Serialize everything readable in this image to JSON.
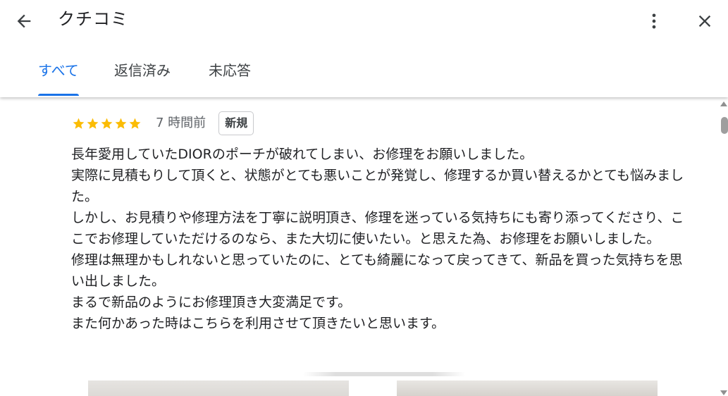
{
  "header": {
    "title": "クチコミ",
    "back_icon": "arrow-left-icon",
    "more_icon": "more-vert-icon",
    "close_icon": "close-icon"
  },
  "tabs": [
    {
      "label": "すべて",
      "active": true
    },
    {
      "label": "返信済み",
      "active": false
    },
    {
      "label": "未応答",
      "active": false
    }
  ],
  "review": {
    "rating": 5,
    "rating_max": 5,
    "star_color": "#fbbc04",
    "time_ago": "7 時間前",
    "badge": "新規",
    "paragraphs": [
      "長年愛用していたDIORのポーチが破れてしまい、お修理をお願いしました。",
      "実際に見積もりして頂くと、状態がとても悪いことが発覚し、修理するか買い替えるかとても悩みました。",
      "しかし、お見積りや修理方法を丁寧に説明頂き、修理を迷っている気持ちにも寄り添ってくださり、ここでお修理していただけるのなら、また大切に使いたい。と思えた為、お修理をお願いしました。",
      "修理は無理かもしれないと思っていたのに、とても綺麗になって戻ってきて、新品を買った気持ちを思い出しました。",
      "まるで新品のようにお修理頂き大変満足です。",
      "また何かあった時はこちらを利用させて頂きたいと思います。"
    ]
  },
  "accent_color": "#1a73e8"
}
